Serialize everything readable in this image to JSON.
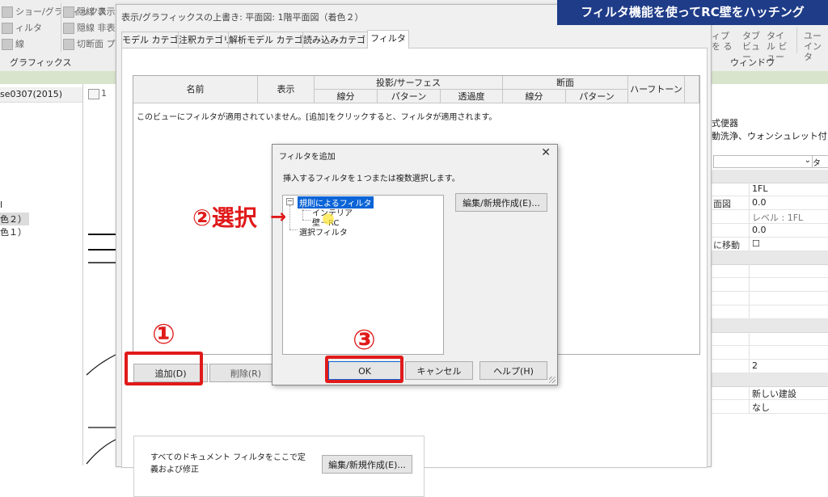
{
  "banner": "フィルタ機能を使ってRC壁をハッチング",
  "ribbon": {
    "items_left": [
      {
        "label": "ショー/グラフィックス",
        "icon": "graphics-icon"
      },
      {
        "label": "ィルタ",
        "icon": "filter-icon"
      },
      {
        "label": "線",
        "icon": "line-icon"
      }
    ],
    "items_mid": [
      {
        "label": "隠線 表示",
        "icon": "show-hidden-lines-icon"
      },
      {
        "label": "隠線 非表",
        "icon": "remove-hidden-lines-icon"
      },
      {
        "label": "切断面 プ",
        "icon": "cut-profile-icon"
      }
    ],
    "group_label": "グラフィックス",
    "right_items": [
      "ィプを る",
      "タブ ビュー",
      "タイル ビュー",
      "ユー インタ"
    ],
    "window_group": "ウィンドウ"
  },
  "project_browser": {
    "header": "se0307(2015)",
    "rows": [
      "l",
      "色２）",
      "色１）"
    ]
  },
  "view_tab_label": "1",
  "properties": {
    "type_name": "式便器",
    "type_desc": "動洗浄、ウォンシュレット付",
    "combo_text": "タ",
    "rows": [
      {
        "k": "",
        "v": "1FL"
      },
      {
        "k": "面図",
        "v": "0.0"
      },
      {
        "k": "",
        "v": "レベル : 1FL"
      },
      {
        "k": "",
        "v": "0.0"
      },
      {
        "k": "に移動",
        "v": "☐"
      },
      {
        "k": "",
        "v": "2"
      },
      {
        "k": "",
        "v": "新しい建設"
      },
      {
        "k": "",
        "v": "なし"
      }
    ]
  },
  "dialog": {
    "title": "表示/グラフィックスの上書き: 平面図: 1階平面図（着色２）",
    "tabs": [
      "モデル カテゴリ",
      "注釈カテゴリ",
      "解析モデル カテゴリ",
      "読み込みカテゴリ",
      "フィルタ"
    ],
    "active_tab": "フィルタ",
    "columns": {
      "name": "名前",
      "visibility": "表示",
      "projection": "投影/サーフェス",
      "cut": "断面",
      "halftone": "ハーフトーン",
      "lines": "線分",
      "patterns": "パターン",
      "transparency": "透過度",
      "cut_lines": "線分",
      "cut_patterns": "パターン"
    },
    "empty_message": "このビューにフィルタが適用されていません。[追加]をクリックすると、フィルタが適用されます。",
    "add_button": "追加(D)",
    "remove_button": "削除(R)",
    "doc_text": "すべてのドキュメント フィルタをここで定義および修正",
    "edit_new_button": "編集/新規作成(E)..."
  },
  "add_filter_dialog": {
    "title": "フィルタを追加",
    "prompt": "挿入するフィルタを１つまたは複数選択します。",
    "tree": {
      "rule_filters": "規則によるフィルタ",
      "children": [
        "インテリア",
        "壁－RC"
      ],
      "selection_filters": "選択フィルタ"
    },
    "edit_new_button": "編集/新規作成(E)...",
    "ok_button": "OK",
    "cancel_button": "キャンセル",
    "help_button": "ヘルプ(H)"
  },
  "annotations": {
    "step1": "①",
    "step2": "②選択",
    "step3": "③",
    "arrow": "→",
    "color": "#e01a1a"
  }
}
